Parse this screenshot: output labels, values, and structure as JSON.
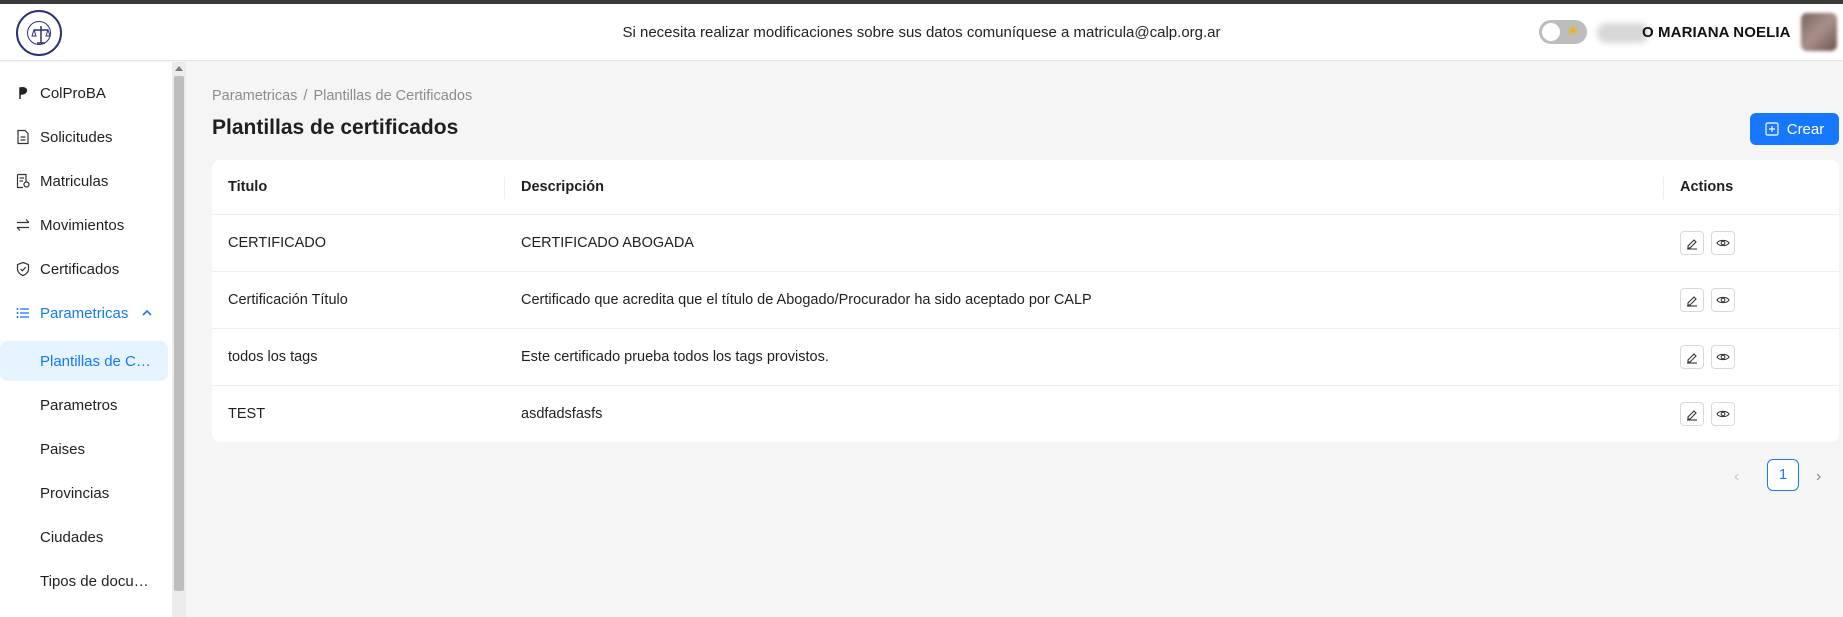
{
  "header": {
    "notice": "Si necesita realizar modificaciones sobre sus datos comuníquese a matricula@calp.org.ar",
    "username": "O MARIANA NOELIA",
    "theme_icon": "sun-icon"
  },
  "sidebar": {
    "items": [
      {
        "label": "ColProBA",
        "icon": "p-logo-icon"
      },
      {
        "label": "Solicitudes",
        "icon": "document-icon"
      },
      {
        "label": "Matriculas",
        "icon": "id-document-icon"
      },
      {
        "label": "Movimientos",
        "icon": "swap-icon"
      },
      {
        "label": "Certificados",
        "icon": "shield-check-icon"
      },
      {
        "label": "Parametricas",
        "icon": "list-icon"
      }
    ],
    "subitems": [
      {
        "label": "Plantillas de Certificados"
      },
      {
        "label": "Parametros"
      },
      {
        "label": "Paises"
      },
      {
        "label": "Provincias"
      },
      {
        "label": "Ciudades"
      },
      {
        "label": "Tipos de documento"
      }
    ]
  },
  "breadcrumb": {
    "parent": "Parametricas",
    "separator": "/",
    "current": "Plantillas de Certificados"
  },
  "page": {
    "title": "Plantillas de certificados",
    "create_label": "Crear"
  },
  "table": {
    "columns": [
      "Titulo",
      "Descripción",
      "Actions"
    ],
    "rows": [
      {
        "titulo": "CERTIFICADO",
        "descripcion": "CERTIFICADO ABOGADA"
      },
      {
        "titulo": "Certificación Título",
        "descripcion": "Certificado que acredita que el título de Abogado/Procurador ha sido aceptado por CALP"
      },
      {
        "titulo": "todos los tags",
        "descripcion": "Este certificado prueba todos los tags provistos."
      },
      {
        "titulo": "TEST",
        "descripcion": "asdfadsfasfs"
      }
    ]
  },
  "pagination": {
    "current_page": "1",
    "prev": "‹",
    "next": "›"
  },
  "colors": {
    "accent": "#1677ff",
    "selected_bg": "#e6f4ff"
  }
}
